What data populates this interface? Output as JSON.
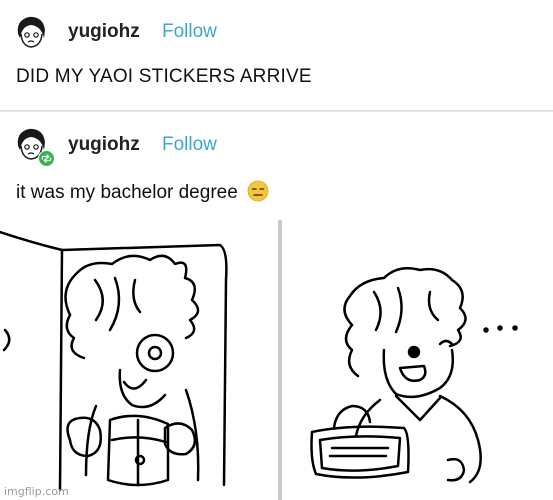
{
  "posts": [
    {
      "username": "yugiohz",
      "follow_label": "Follow",
      "text": "DID MY YAOI STICKERS ARRIVE",
      "avatar_icon": "avatar-face-icon"
    },
    {
      "username": "yugiohz",
      "follow_label": "Follow",
      "text": "it was my bachelor degree",
      "avatar_icon": "avatar-face-icon",
      "badge_icon": "reblog-icon",
      "emoji_icon": "expressionless-emoji-icon"
    }
  ],
  "watermark": "imgflip.com",
  "colors": {
    "follow": "#3ea7cf",
    "badge": "#2fb84a",
    "emoji": "#f5c53b"
  }
}
